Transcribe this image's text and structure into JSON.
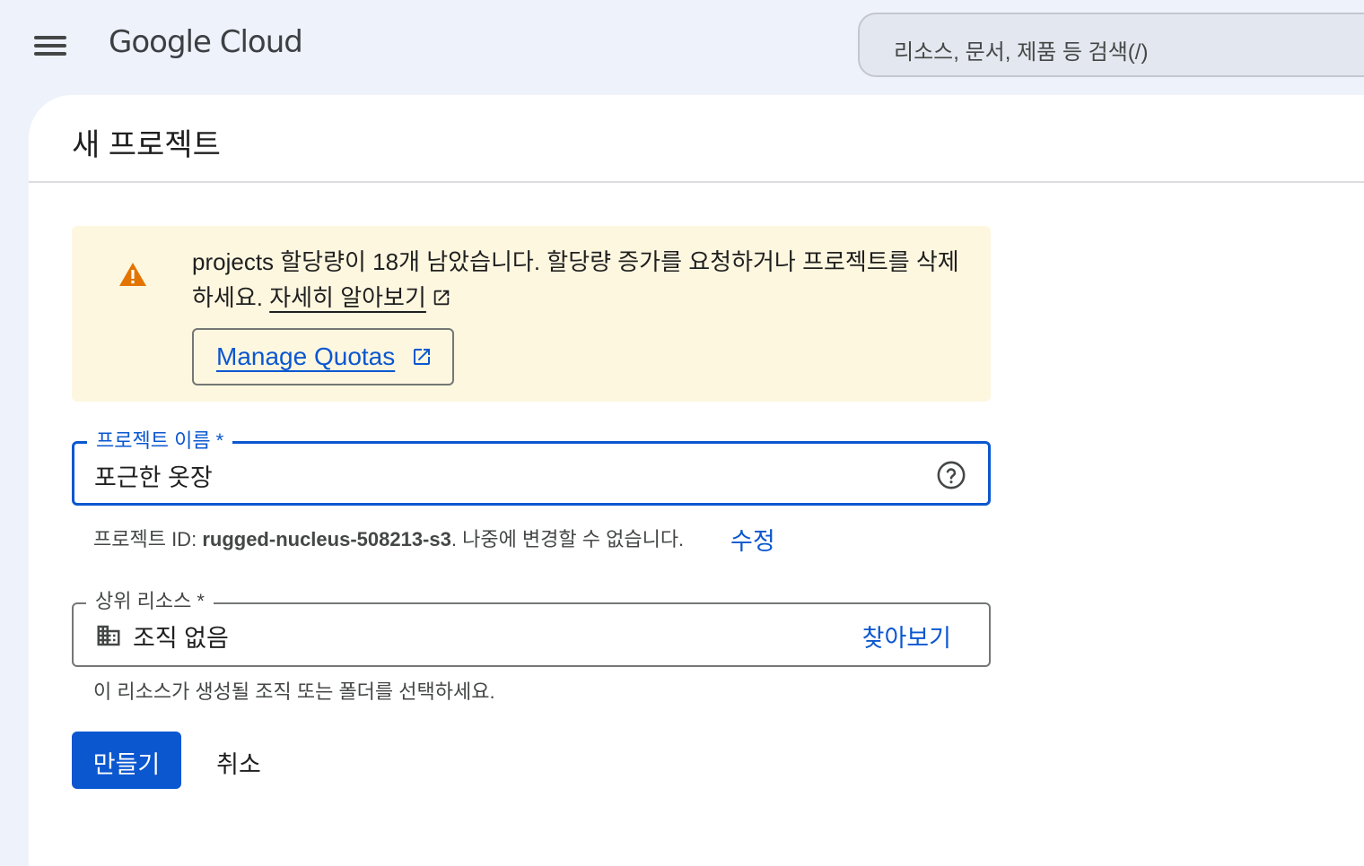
{
  "header": {
    "logo_text": "Google Cloud",
    "search_placeholder": "리소스, 문서, 제품 등 검색(/)"
  },
  "page": {
    "title": "새 프로젝트"
  },
  "alert": {
    "message": "projects 할당량이 18개 남았습니다. 할당량 증가를 요청하거나 프로젝트를 삭제하세요.",
    "learn_more_label": "자세히 알아보기",
    "manage_quotas_label": "Manage Quotas"
  },
  "form": {
    "project_name": {
      "label": "프로젝트 이름 *",
      "value": "포근한 옷장"
    },
    "project_id": {
      "prefix": "프로젝트 ID:",
      "id": "rugged-nucleus-508213-s3",
      "suffix": ". 나중에 변경할 수 없습니다.",
      "edit_label": "수정"
    },
    "parent_resource": {
      "label": "상위 리소스 *",
      "value": "조직 없음",
      "browse_label": "찾아보기",
      "helper": "이 리소스가 생성될 조직 또는 폴더를 선택하세요."
    }
  },
  "actions": {
    "create_label": "만들기",
    "cancel_label": "취소"
  },
  "icons": {
    "menu": "hamburger-menu-icon",
    "warning": "warning-icon",
    "external_link": "open-in-new-icon",
    "help": "help-circle-icon",
    "organization": "domain-building-icon"
  },
  "colors": {
    "accent": "#0b57d0",
    "warning_bg": "#fef7e0",
    "warning_icon": "#e37400",
    "page_bg": "#eef2fb"
  }
}
